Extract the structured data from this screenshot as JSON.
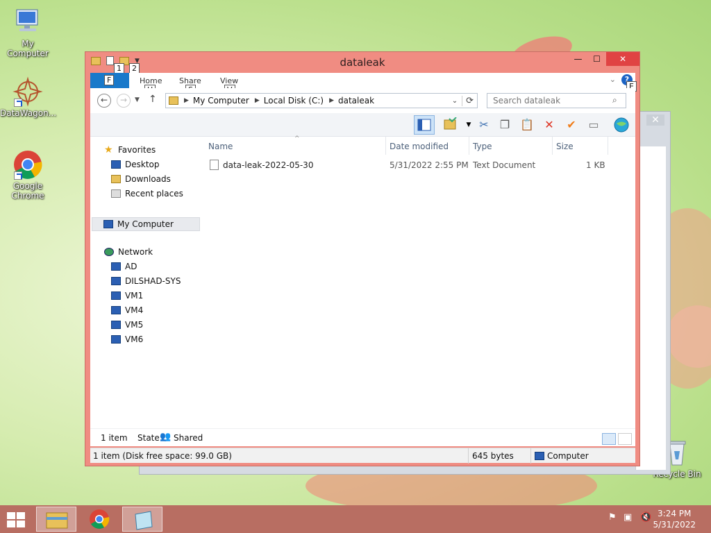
{
  "desktop": {
    "icons": [
      {
        "label": "My Computer"
      },
      {
        "label": "DataWagon..."
      },
      {
        "label": "Google Chrome"
      },
      {
        "label": "Recycle Bin"
      }
    ]
  },
  "window": {
    "title": "dataleak",
    "keytips": {
      "qat1": "1",
      "qat2": "2",
      "file": "F",
      "home": "H",
      "share": "S",
      "view": "V",
      "help": "E"
    },
    "ribbon_tabs": {
      "home": "Home",
      "share": "Share",
      "view": "View"
    },
    "help_label": "?",
    "breadcrumb": [
      "My Computer",
      "Local Disk (C:)",
      "dataleak"
    ],
    "search_placeholder": "Search dataleak",
    "nav": {
      "favorites": "Favorites",
      "desktop": "Desktop",
      "downloads": "Downloads",
      "recent": "Recent places",
      "computer": "My Computer",
      "network": "Network",
      "hosts": [
        "AD",
        "DILSHAD-SYS",
        "VM1",
        "VM4",
        "VM5",
        "VM6"
      ]
    },
    "columns": {
      "name": "Name",
      "date": "Date modified",
      "type": "Type",
      "size": "Size"
    },
    "files": [
      {
        "name": "data-leak-2022-05-30",
        "date": "5/31/2022 2:55 PM",
        "type": "Text Document",
        "size": "1 KB"
      }
    ],
    "status": {
      "count": "1 item",
      "state_label": "State:",
      "state_value": "Shared"
    },
    "details": {
      "summary": "1 item (Disk free space: 99.0 GB)",
      "size": "645 bytes",
      "location": "Computer"
    }
  },
  "taskbar": {
    "time": "3:24 PM",
    "date": "5/31/2022"
  },
  "colors": {
    "titlebar": "#f08c82",
    "taskbar": "#b86e62",
    "accent": "#1979ca",
    "close": "#e04343"
  }
}
